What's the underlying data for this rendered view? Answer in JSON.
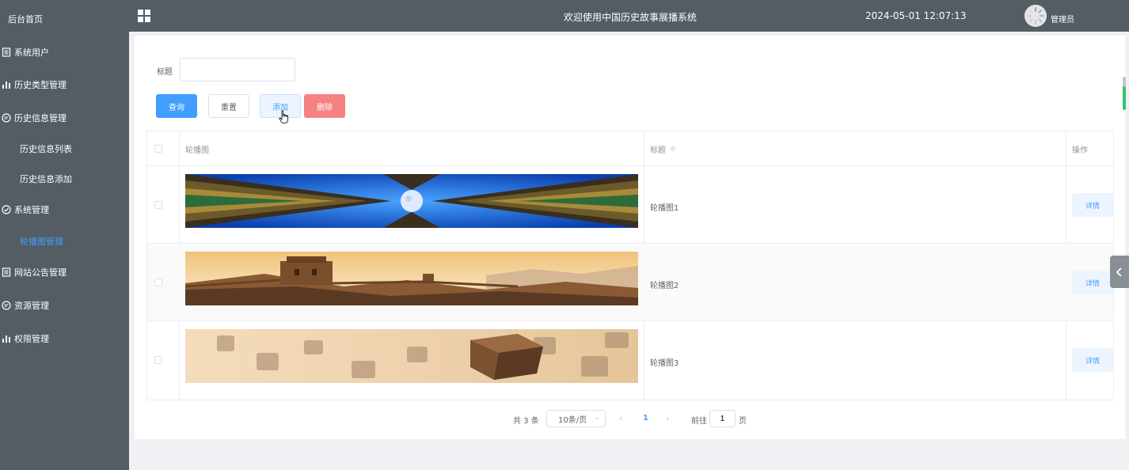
{
  "sidebar": {
    "home": "后台首页",
    "items": [
      {
        "label": "系统用户",
        "icon": "document-icon"
      },
      {
        "label": "历史类型管理",
        "icon": "bar-chart-icon"
      },
      {
        "label": "历史信息管理",
        "icon": "chat-bubble-icon"
      },
      {
        "label": "历史信息列表",
        "icon": ""
      },
      {
        "label": "历史信息添加",
        "icon": ""
      },
      {
        "label": "系统管理",
        "icon": "check-circle-icon"
      },
      {
        "label": "轮播图管理",
        "icon": ""
      },
      {
        "label": "网站公告管理",
        "icon": "document-icon"
      },
      {
        "label": "资源管理",
        "icon": "chat-bubble-icon"
      },
      {
        "label": "权限管理",
        "icon": "bar-chart-icon"
      }
    ]
  },
  "header": {
    "welcome": "欢迎使用中国历史故事展播系统",
    "datetime": "2024-05-01 12:07:13",
    "user": "管理员"
  },
  "search": {
    "label": "标题",
    "value": ""
  },
  "buttons": {
    "query": "查询",
    "reset": "重置",
    "add": "添加",
    "delete": "删除"
  },
  "table": {
    "columns": [
      "轮播图",
      "标题",
      "操作"
    ],
    "sort_indicator": "≑",
    "rows": [
      {
        "title": "轮播图1",
        "action": "详情",
        "image": "palace-eaves-moon"
      },
      {
        "title": "轮播图2",
        "action": "详情",
        "image": "great-wall-sunset"
      },
      {
        "title": "轮播图3",
        "action": "详情",
        "image": "calligraphy-seal"
      }
    ]
  },
  "pagination": {
    "total": "共 3 条",
    "page_size": "10条/页",
    "current": "1",
    "goto": "前往",
    "jump_value": "1",
    "page_suffix": "页"
  },
  "colors": {
    "sidebar_bg": "#545c64",
    "primary": "#409eff",
    "danger": "#f56c6c",
    "active_menu": "#409eff"
  }
}
